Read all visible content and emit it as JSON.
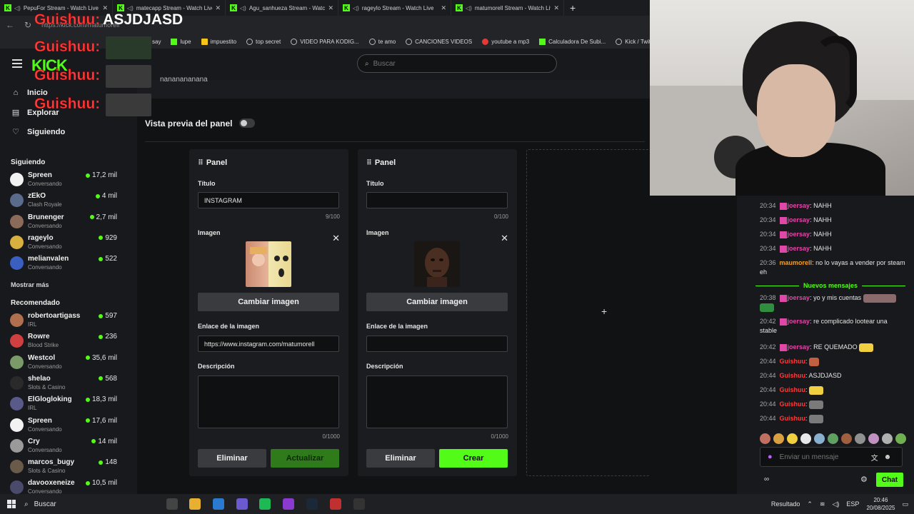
{
  "browser": {
    "tabs": [
      {
        "label": "PepuFor Stream - Watch Live"
      },
      {
        "label": "matecapp Stream - Watch Live"
      },
      {
        "label": "Agu_sanhueza Stream - Watch Live"
      },
      {
        "label": "rageylo Stream - Watch Live"
      },
      {
        "label": "matumorell Stream - Watch Live"
      }
    ],
    "tab_close": "✕",
    "new_tab": "+",
    "url": "https://kick.com/matumorell",
    "bookmarks": [
      {
        "label": "say",
        "icon": "globe-icon"
      },
      {
        "label": "lupe",
        "icon": "kick-icon"
      },
      {
        "label": "impuestito",
        "icon": "yellow-icon"
      },
      {
        "label": "top secret",
        "icon": "globe-icon"
      },
      {
        "label": "VIDEO PARA KODIG...",
        "icon": "globe-icon"
      },
      {
        "label": "te amo",
        "icon": "globe-icon"
      },
      {
        "label": "CANCIONES VIDEOS",
        "icon": "globe-icon"
      },
      {
        "label": "youtube a mp3",
        "icon": "red-icon"
      },
      {
        "label": "Calculadora De Subi...",
        "icon": "kick-icon"
      },
      {
        "label": "Kick / Twitch VOD",
        "icon": "globe-icon"
      }
    ]
  },
  "header": {
    "logo": "KICK",
    "search_placeholder": "Buscar"
  },
  "sidebar": {
    "nav": [
      {
        "label": "Inicio",
        "icon": "home-icon"
      },
      {
        "label": "Explorar",
        "icon": "explore-icon"
      },
      {
        "label": "Siguiendo",
        "icon": "heart-icon"
      }
    ],
    "following_title": "Siguiendo",
    "following": [
      {
        "name": "Spreen",
        "category": "Conversando",
        "viewers": "17,2 mil",
        "color": "#f2f2f2"
      },
      {
        "name": "zEkO",
        "category": "Clash Royale",
        "viewers": "4 mil",
        "color": "#5a6b8c"
      },
      {
        "name": "Brunenger",
        "category": "Conversando",
        "viewers": "2,7 mil",
        "color": "#8c6a5a"
      },
      {
        "name": "rageylo",
        "category": "Conversando",
        "viewers": "929",
        "color": "#d8b040"
      },
      {
        "name": "melianvalen",
        "category": "Conversando",
        "viewers": "522",
        "color": "#3a5fc0"
      }
    ],
    "show_more": "Mostrar más",
    "recommended_title": "Recomendado",
    "recommended": [
      {
        "name": "robertoartigass",
        "category": "IRL",
        "viewers": "597",
        "color": "#b07050"
      },
      {
        "name": "Rowre",
        "category": "Blood Strike",
        "viewers": "236",
        "color": "#d04040"
      },
      {
        "name": "Westcol",
        "category": "Conversando",
        "viewers": "35,6 mil",
        "color": "#7a9a6a"
      },
      {
        "name": "shelao",
        "category": "Slots & Casino",
        "viewers": "568",
        "color": "#2a2a2a"
      },
      {
        "name": "ElGlogloking",
        "category": "IRL",
        "viewers": "18,3 mil",
        "color": "#5a5a8a"
      },
      {
        "name": "Spreen",
        "category": "Conversando",
        "viewers": "17,6 mil",
        "color": "#f2f2f2"
      },
      {
        "name": "Cry",
        "category": "Conversando",
        "viewers": "14 mil",
        "color": "#9a9a9a"
      },
      {
        "name": "marcos_bugy",
        "category": "Slots & Casino",
        "viewers": "148",
        "color": "#6a5a4a"
      },
      {
        "name": "davooxeneize",
        "category": "Conversando",
        "viewers": "10,5 mil",
        "color": "#4a4a6a"
      }
    ]
  },
  "main": {
    "top_text": "nananananana",
    "preview_label": "Vista previa del panel",
    "panels": [
      {
        "header": "Panel",
        "title_label": "Título",
        "title_value": "INSTAGRAM",
        "title_counter": "9/100",
        "image_label": "Imagen",
        "change_image": "Cambiar imagen",
        "link_label": "Enlace de la imagen",
        "link_value": "https://www.instagram.com/matumorell",
        "desc_label": "Descripción",
        "desc_value": "",
        "desc_counter": "0/1000",
        "delete": "Eliminar",
        "submit": "Actualizar"
      },
      {
        "header": "Panel",
        "title_label": "Título",
        "title_value": "",
        "title_counter": "0/100",
        "image_label": "Imagen",
        "change_image": "Cambiar imagen",
        "link_label": "Enlace de la imagen",
        "link_value": "",
        "desc_label": "Descripción",
        "desc_value": "",
        "desc_counter": "0/1000",
        "delete": "Eliminar",
        "submit": "Crear"
      }
    ],
    "add_panel": "+"
  },
  "alerts": [
    {
      "user": "Guishuu:",
      "text": "ASJDJASD"
    },
    {
      "user": "Guishuu:",
      "text": ""
    },
    {
      "user": "Guishuu:",
      "text": ""
    },
    {
      "user": "Guishuu:",
      "text": ""
    }
  ],
  "chat": {
    "new_messages": "Nuevos mensajes",
    "messages": [
      {
        "time": "20:34",
        "user": "joersay",
        "text": "NAHH",
        "cls": "u-pink",
        "badge": true
      },
      {
        "time": "20:34",
        "user": "joersay",
        "text": "NAHH",
        "cls": "u-pink",
        "badge": true
      },
      {
        "time": "20:34",
        "user": "joersay",
        "text": "NAHH",
        "cls": "u-pink",
        "badge": true
      },
      {
        "time": "20:34",
        "user": "joersay",
        "text": "NAHH",
        "cls": "u-pink",
        "badge": true
      },
      {
        "time": "20:36",
        "user": "maumorell",
        "text": "no lo vayas a vender por steam eh",
        "cls": "u-orange",
        "badge": false
      },
      {
        "time": "20:38",
        "user": "joersay",
        "text": "yo y mis cuentas",
        "cls": "u-pink",
        "badge": true
      },
      {
        "time": "20:42",
        "user": "joersay",
        "text": "re complicado lootear una stable",
        "cls": "u-pink",
        "badge": true
      },
      {
        "time": "20:42",
        "user": "joersay",
        "text": "RE QUEMADO",
        "cls": "u-pink",
        "badge": true
      },
      {
        "time": "20:44",
        "user": "Guishuu",
        "text": "",
        "cls": "u-red",
        "badge": false
      },
      {
        "time": "20:44",
        "user": "Guishuu",
        "text": "ASJDJASD",
        "cls": "u-red",
        "badge": false
      },
      {
        "time": "20:44",
        "user": "Guishuu",
        "text": "",
        "cls": "u-red",
        "badge": false
      },
      {
        "time": "20:44",
        "user": "Guishuu",
        "text": "",
        "cls": "u-red",
        "badge": false
      },
      {
        "time": "20:44",
        "user": "Guishuu",
        "text": "",
        "cls": "u-red",
        "badge": false
      }
    ],
    "input_placeholder": "Enviar un mensaje",
    "send": "Chat"
  },
  "taskbar": {
    "search": "Buscar",
    "weather": "Resultado",
    "lang": "ESP",
    "time": "20:46",
    "date": "20/08/2025"
  },
  "colors": {
    "accent": "#53fc18",
    "background": "#111214",
    "panel": "#1b1c1f"
  }
}
